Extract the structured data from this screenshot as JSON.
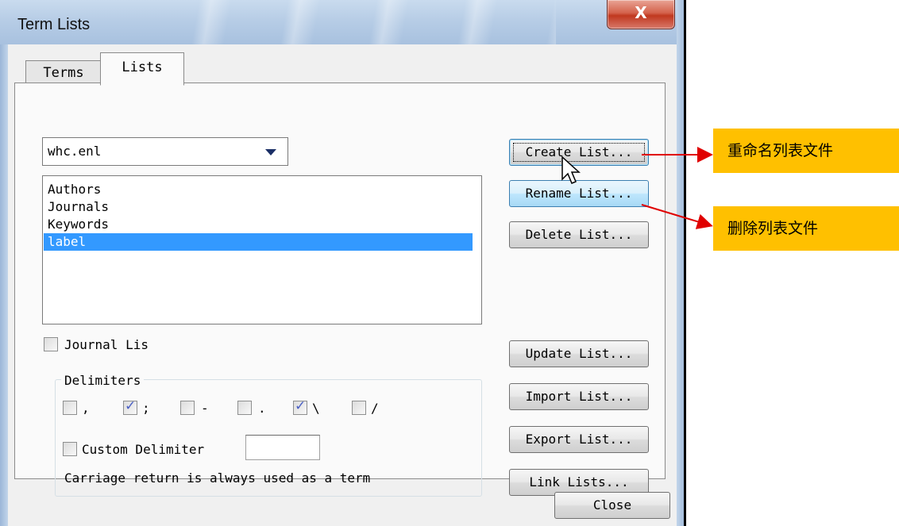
{
  "window": {
    "title": "Term Lists",
    "close_glyph": "X"
  },
  "tabs": [
    {
      "label": "Terms",
      "selected": false
    },
    {
      "label": "Lists",
      "selected": true
    }
  ],
  "list_file_select": {
    "value": "whc.enl"
  },
  "term_lists": {
    "items": [
      "Authors",
      "Journals",
      "Keywords",
      "label"
    ],
    "selected_index": 3
  },
  "buttons": {
    "create": "Create List...",
    "rename": "Rename List...",
    "delete": "Delete List...",
    "update": "Update List...",
    "import": "Import List...",
    "export": "Export List...",
    "link": "Link Lists...",
    "close": "Close"
  },
  "journal_list": {
    "label": "Journal Lis",
    "checked": false
  },
  "delimiters": {
    "title": "Delimiters",
    "options": [
      {
        "label": ",",
        "checked": false
      },
      {
        "label": ";",
        "checked": true
      },
      {
        "label": "-",
        "checked": false
      },
      {
        "label": ".",
        "checked": false
      },
      {
        "label": "\\",
        "checked": true
      },
      {
        "label": "/",
        "checked": false
      }
    ],
    "custom_label": "Custom Delimiter",
    "custom_checked": false,
    "custom_value": "",
    "note": "Carriage return is always used as a term"
  },
  "annotations": {
    "rename_callout": "重命名列表文件",
    "delete_callout": "删除列表文件",
    "arrow_color": "#e00000",
    "callout_color": "#ffc000"
  }
}
